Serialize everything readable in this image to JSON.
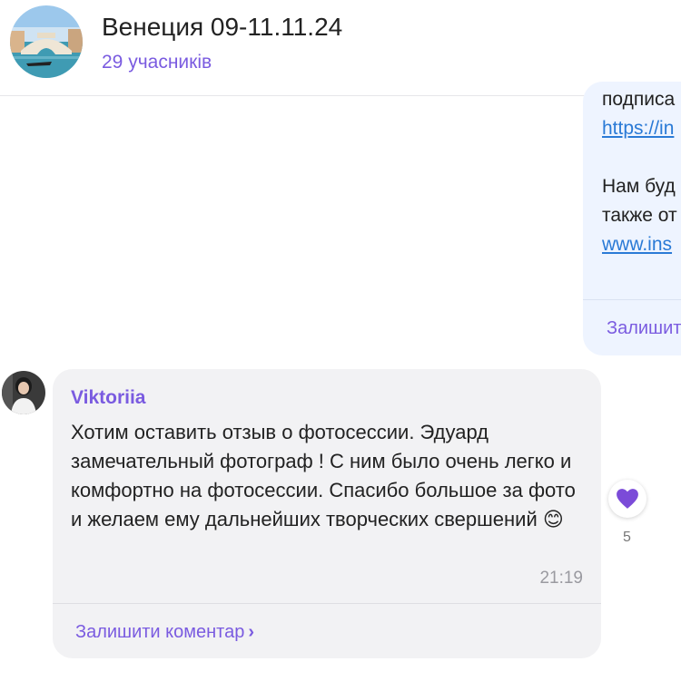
{
  "header": {
    "title": "Венеция 09-11.11.24",
    "subtitle": "29 учасників"
  },
  "prev_message": {
    "line1": "подписа",
    "link1": "https://in",
    "line2": "Нам буд",
    "line3": "также от",
    "link2": "www.ins",
    "comment_label": "Залишит"
  },
  "message": {
    "sender": "Viktoriia",
    "text": "Хотим оставить отзыв о фотосессии.  Эдуард замечательный фотограф ! С ним было очень легко и комфортно на фотосессии. Спасибо большое за фото и желаем ему дальнейших творческих свершений",
    "emoji": "😊",
    "time": "21:19",
    "comment_label": "Залишити коментар",
    "reaction_icon": "purple-heart-icon",
    "reaction_count": "5"
  },
  "colors": {
    "accent": "#7a5be0",
    "link": "#2a7ad6",
    "own_bubble": "#eef4ff",
    "other_bubble": "#f2f2f4"
  }
}
